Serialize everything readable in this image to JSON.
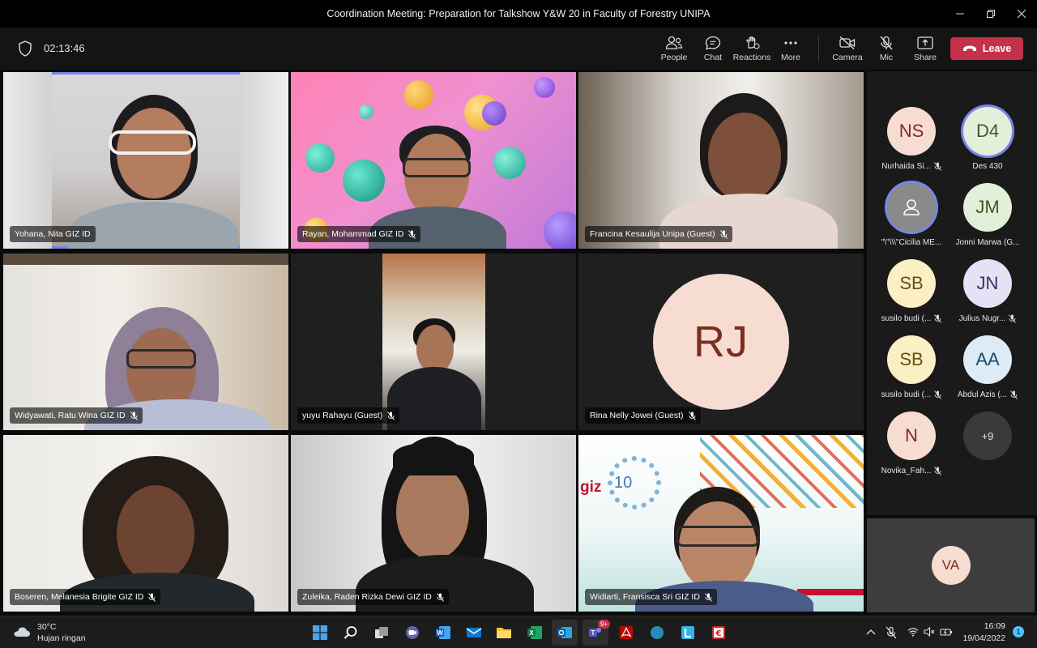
{
  "window": {
    "title": "Coordination Meeting: Preparation for Talkshow Y&W 20 in Faculty of Forestry UNIPA"
  },
  "toolbar": {
    "timer": "02:13:46",
    "buttons": [
      {
        "label": "People",
        "icon": "people-icon"
      },
      {
        "label": "Chat",
        "icon": "chat-icon"
      },
      {
        "label": "Reactions",
        "icon": "reactions-icon"
      },
      {
        "label": "More",
        "icon": "more-icon"
      },
      {
        "label": "Camera",
        "icon": "camera-off-icon"
      },
      {
        "label": "Mic",
        "icon": "mic-off-icon"
      },
      {
        "label": "Share",
        "icon": "share-icon"
      }
    ],
    "leave_label": "Leave"
  },
  "tiles": [
    {
      "name": "Yohana, Nita GIZ ID",
      "muted": false
    },
    {
      "name": "Rayan, Mohammad GIZ ID",
      "muted": true
    },
    {
      "name": "Francina Kesaulija Unipa (Guest)",
      "muted": true
    },
    {
      "name": "Widyawati, Ratu Wina GIZ ID",
      "muted": true
    },
    {
      "name": "yuyu Rahayu (Guest)",
      "muted": true
    },
    {
      "name": "Rina Nelly Jowei (Guest)",
      "muted": true,
      "initials": "RJ"
    },
    {
      "name": "Boseren, Melanesia Brigite GIZ ID",
      "muted": true
    },
    {
      "name": "Zuleika, Raden Rizka Dewi GIZ ID",
      "muted": true
    },
    {
      "name": "Widiarti, Fransisca Sri GIZ ID",
      "muted": true
    }
  ],
  "tile9_logo": {
    "brand": "giz",
    "number": "10"
  },
  "roster": [
    {
      "initials": "NS",
      "label": "Nurhaida Si...",
      "muted": true,
      "bg": "#f7dcd2",
      "fg": "#7a2f1e"
    },
    {
      "initials": "D4",
      "label": "Des 430",
      "muted": false,
      "bg": "#e3f0d9",
      "fg": "#3b5a24",
      "ring": true
    },
    {
      "initials": "",
      "label": "\"\\\"\\\\\\\"Cicilia ME...",
      "muted": false,
      "bg": "#8a8a8a",
      "fg": "#ffffff",
      "ring": true,
      "icon": "person-icon"
    },
    {
      "initials": "JM",
      "label": "Jonni Marwa (G...",
      "muted": false,
      "bg": "#e3f0d9",
      "fg": "#3b5a24"
    },
    {
      "initials": "SB",
      "label": "susilo budi (...",
      "muted": true,
      "bg": "#fbefc5",
      "fg": "#6b4f0f"
    },
    {
      "initials": "JN",
      "label": "Julius Nugr...",
      "muted": true,
      "bg": "#e3e3f5",
      "fg": "#37306b"
    },
    {
      "initials": "SB",
      "label": "susilo budi (...",
      "muted": true,
      "bg": "#fbefc5",
      "fg": "#6b4f0f"
    },
    {
      "initials": "AA",
      "label": "Abdul Azis (...",
      "muted": true,
      "bg": "#dcebf5",
      "fg": "#1f4a6b"
    },
    {
      "initials": "N",
      "label": "Novika_Fah...",
      "muted": true,
      "bg": "#f7dcd2",
      "fg": "#7a2f1e"
    },
    {
      "initials": "+9",
      "label": "",
      "muted": false,
      "bg": "#3a3a3a",
      "fg": "#e0e0e0"
    }
  ],
  "self_view": {
    "initials": "VA"
  },
  "taskbar": {
    "weather_temp": "30°C",
    "weather_desc": "Hujan ringan",
    "apps": [
      {
        "icon": "windows-start-icon"
      },
      {
        "icon": "search-icon"
      },
      {
        "icon": "task-view-icon"
      },
      {
        "icon": "teams-chat-icon"
      },
      {
        "icon": "word-icon"
      },
      {
        "icon": "mail-icon"
      },
      {
        "icon": "file-explorer-icon"
      },
      {
        "icon": "excel-icon"
      },
      {
        "icon": "outlook-icon"
      },
      {
        "icon": "teams-icon",
        "badge": "9+"
      },
      {
        "icon": "acrobat-icon"
      },
      {
        "icon": "edge-icon"
      },
      {
        "icon": "launcher-l-icon"
      },
      {
        "icon": "euro-app-icon"
      }
    ],
    "time": "16:09",
    "date": "19/04/2022",
    "notification_count": "1"
  },
  "colors": {
    "accent": "#7b83eb",
    "leave": "#c4314b"
  }
}
